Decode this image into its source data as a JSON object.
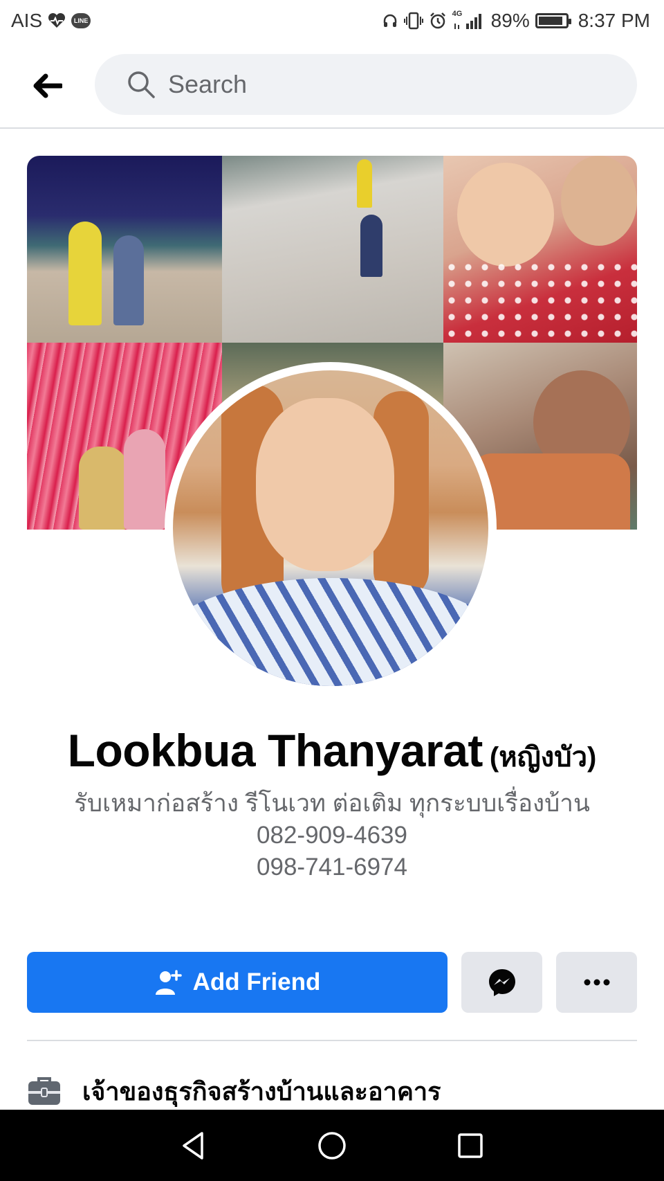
{
  "status_bar": {
    "carrier": "AIS",
    "line_badge": "LINE",
    "network": "4G",
    "battery": "89%",
    "battery_level": 0.89,
    "time": "8:37 PM"
  },
  "search": {
    "placeholder": "Search"
  },
  "profile": {
    "name": "Lookbua Thanyarat",
    "alternate_name": "(หญิงบัว)",
    "bio_lines": [
      "รับเหมาก่อสร้าง รีโนเวท ต่อเติม ทุกระบบเรื่องบ้าน",
      "082-909-4639",
      "098-741-6974"
    ]
  },
  "actions": {
    "add_friend_label": "Add Friend",
    "message_icon": "messenger-icon",
    "more_icon": "more-dots-icon",
    "accent_color": "#1877f2"
  },
  "info": {
    "work_icon": "briefcase-icon",
    "work_text": "เจ้าของธุรกิจสร้างบ้านและอาคาร"
  },
  "cover": {
    "photos": [
      "beach-night",
      "beach-kids",
      "selfie-friends",
      "red-ribbons-family",
      "outdoor-scene",
      "kids-peace-sign"
    ]
  }
}
